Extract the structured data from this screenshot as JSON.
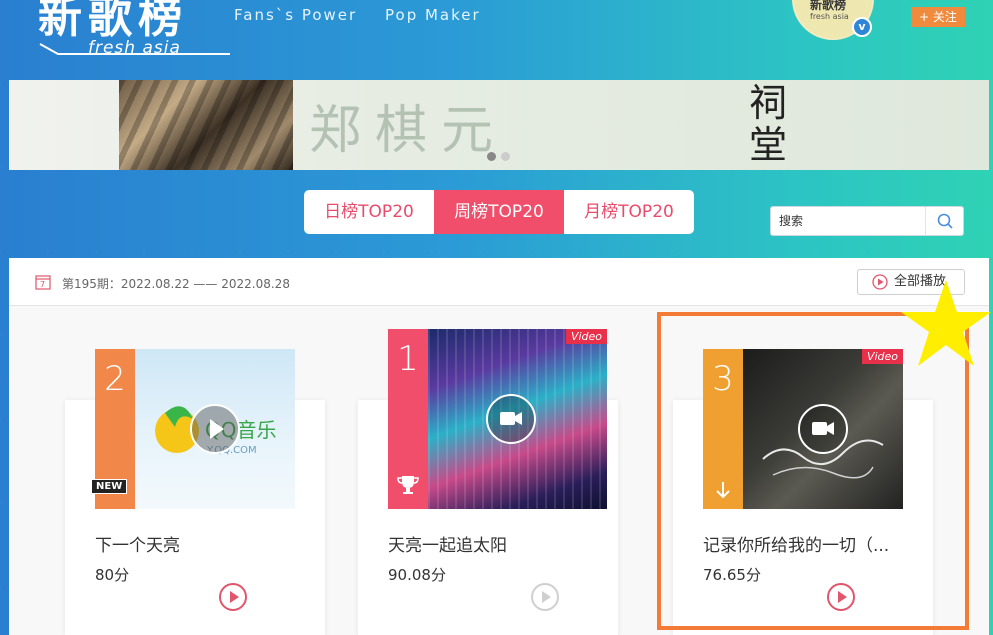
{
  "header": {
    "logo_cn": "新歌榜",
    "logo_en": "fresh asia",
    "taglines": [
      "Fans`s Power",
      "Pop Maker"
    ],
    "avatar_title": "新歌榜",
    "avatar_sub": "fresh asia",
    "follow_label": "+ 关注"
  },
  "banner": {
    "artist": "郑棋元",
    "song": "祠堂"
  },
  "tabs": [
    {
      "label": "日榜TOP20",
      "active": false
    },
    {
      "label": "周榜TOP20",
      "active": true
    },
    {
      "label": "月榜TOP20",
      "active": false
    }
  ],
  "search": {
    "placeholder": "搜索"
  },
  "period": {
    "text": "第195期：2022.08.22 —— 2022.08.28",
    "play_all_label": "全部播放"
  },
  "cards": [
    {
      "rank": "2",
      "title": "下一个天亮",
      "score": "80分",
      "badge": "NEW",
      "media": "audio",
      "rank_color": "#f2874a"
    },
    {
      "rank": "1",
      "title": "天亮一起追太阳",
      "score": "90.08分",
      "media": "video",
      "video_label": "Video",
      "rank_color": "#f04e6a"
    },
    {
      "rank": "3",
      "title": "记录你所给我的一切（...",
      "score": "76.65分",
      "media": "video",
      "video_label": "Video",
      "trend": "down",
      "rank_color": "#f0a030"
    }
  ],
  "cover_text": {
    "qq_music": "QQ音乐",
    "qq_url": "Y.QQ.COM"
  },
  "colors": {
    "accent": "#f04e6a",
    "highlight": "#f47b35",
    "star": "#ffee00"
  }
}
